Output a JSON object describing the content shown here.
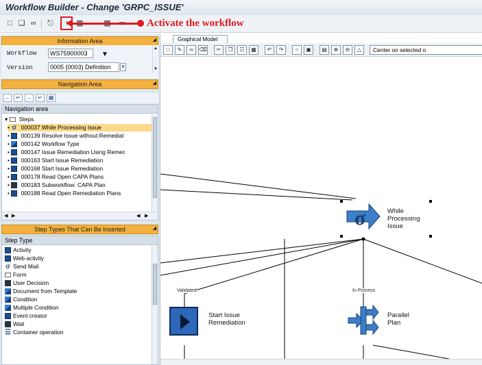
{
  "window": {
    "title": "Workflow Builder - Change 'GRPC_ISSUE'"
  },
  "toolbar": {
    "icons": [
      "new-icon",
      "open-icon",
      "glasses-icon",
      "hierarchy-icon",
      "activate-icon",
      "display-icon",
      "check-icon",
      "print-icon"
    ],
    "annotation": "Activate the workflow",
    "annotation_color": "#e0181e"
  },
  "information_area": {
    "header": "Information Area",
    "workflow_label": "Workflow",
    "workflow_value": "WS75900003",
    "version_label": "Version",
    "version_value": "0005 (0003) Definition"
  },
  "navigation_area": {
    "header": "Navigation Area",
    "tree_header": "Navigation area",
    "root": "Steps",
    "items": [
      {
        "id": "000037",
        "label": "000037 While Processing Issue",
        "icon": "sigma-icon",
        "selected": true
      },
      {
        "id": "000139",
        "label": "000139 Resolve Issue without Remediat",
        "icon": "activity-icon",
        "selected": false
      },
      {
        "id": "000142",
        "label": "000142 Workflow Type",
        "icon": "workflow-type-icon",
        "selected": false
      },
      {
        "id": "000147",
        "label": "000147 Issue Remediation Using Remec",
        "icon": "activity-icon",
        "selected": false
      },
      {
        "id": "000163",
        "label": "000163 Start Issue Remediation",
        "icon": "activity-icon",
        "selected": false
      },
      {
        "id": "000168",
        "label": "000168 Start Issue Remediation",
        "icon": "activity-icon",
        "selected": false
      },
      {
        "id": "000178",
        "label": "000178 Read Open CAPA Plans",
        "icon": "activity-icon",
        "selected": false
      },
      {
        "id": "000183",
        "label": "000183 Subworkflow: CAPA Plan",
        "icon": "subworkflow-icon",
        "selected": false
      },
      {
        "id": "000188",
        "label": "000188 Read Open Remediation Plans",
        "icon": "activity-icon",
        "selected": false
      }
    ]
  },
  "step_types": {
    "header": "Step Types That Can Be Inserted",
    "column": "Step Type",
    "items": [
      {
        "label": "Activity",
        "icon": "activity-icon"
      },
      {
        "label": "Web activity",
        "icon": "web-activity-icon"
      },
      {
        "label": "Send Mail",
        "icon": "send-mail-icon"
      },
      {
        "label": "Form",
        "icon": "form-icon"
      },
      {
        "label": "User Decision",
        "icon": "user-decision-icon"
      },
      {
        "label": "Document from Template",
        "icon": "document-icon"
      },
      {
        "label": "Condition",
        "icon": "condition-icon"
      },
      {
        "label": "Multiple Condition",
        "icon": "multiple-condition-icon"
      },
      {
        "label": "Event creator",
        "icon": "event-creator-icon"
      },
      {
        "label": "Wait",
        "icon": "wait-icon"
      },
      {
        "label": "Container operation",
        "icon": "container-operation-icon"
      }
    ]
  },
  "graphical_model": {
    "tab": "Graphical Model",
    "center_button": "Center on selected o",
    "nodes": [
      {
        "label_line1": "While",
        "label_line2": "Processing",
        "label_line3": "Issue",
        "icon": "loop-icon"
      },
      {
        "label_line1": "Start Issue",
        "label_line2": "Remediation",
        "icon": "activity-icon"
      },
      {
        "label_line1": "Parallel",
        "label_line2": "Plan",
        "icon": "fork-icon"
      }
    ],
    "edges": [
      {
        "label": "Validated"
      },
      {
        "label": "In Process"
      }
    ]
  }
}
